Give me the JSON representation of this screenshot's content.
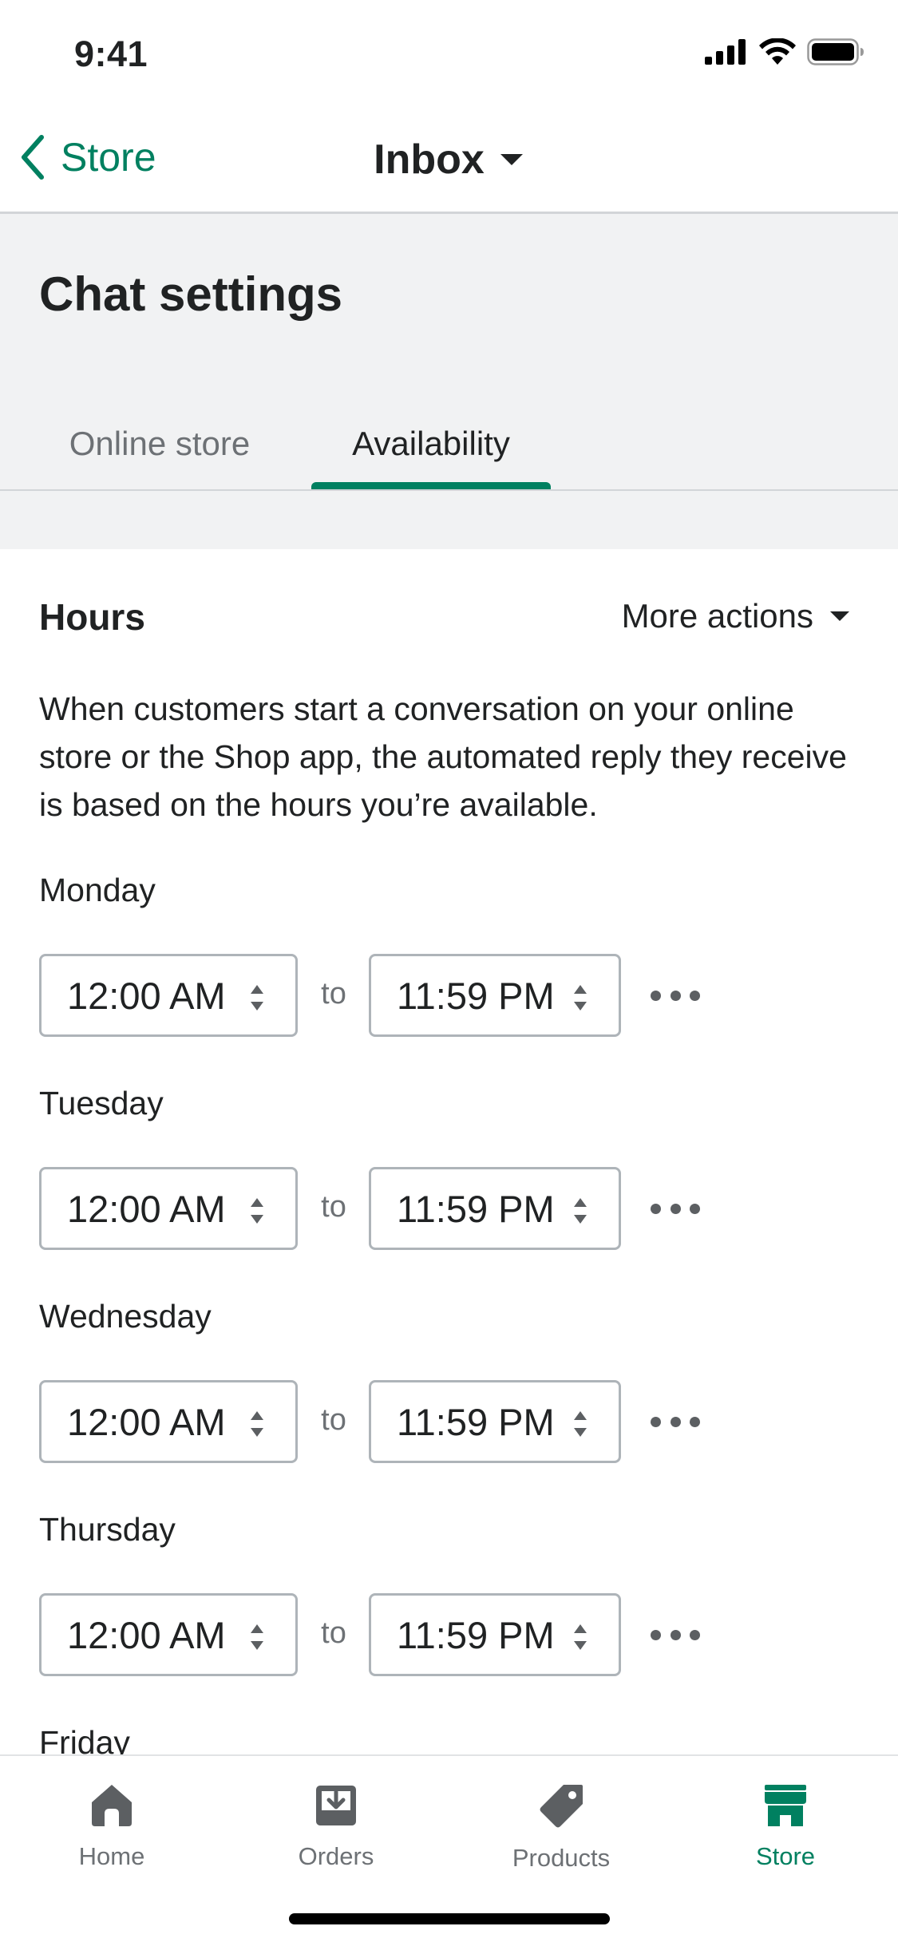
{
  "status_bar": {
    "time": "9:41"
  },
  "nav": {
    "back_label": "Store",
    "title": "Inbox"
  },
  "page": {
    "title": "Chat settings"
  },
  "tabs": [
    {
      "label": "Online store",
      "active": false
    },
    {
      "label": "Availability",
      "active": true
    }
  ],
  "hours": {
    "title": "Hours",
    "more_actions": "More actions",
    "description": "When customers start a conversation on your online store or the Shop app, the automated reply they receive is based on the hours you’re available.",
    "separator": "to",
    "days": [
      {
        "name": "Monday",
        "start": "12:00 AM",
        "end": "11:59 PM"
      },
      {
        "name": "Tuesday",
        "start": "12:00 AM",
        "end": "11:59 PM"
      },
      {
        "name": "Wednesday",
        "start": "12:00 AM",
        "end": "11:59 PM"
      },
      {
        "name": "Thursday",
        "start": "12:00 AM",
        "end": "11:59 PM"
      },
      {
        "name": "Friday"
      }
    ]
  },
  "tab_bar": {
    "items": [
      {
        "label": "Home",
        "icon": "home-icon",
        "active": false
      },
      {
        "label": "Orders",
        "icon": "orders-icon",
        "active": false
      },
      {
        "label": "Products",
        "icon": "products-tag-icon",
        "active": false
      },
      {
        "label": "Store",
        "icon": "store-icon",
        "active": true
      }
    ]
  },
  "colors": {
    "accent": "#008060",
    "text": "#202223",
    "muted": "#6d7175",
    "header_bg": "#f1f2f3"
  }
}
